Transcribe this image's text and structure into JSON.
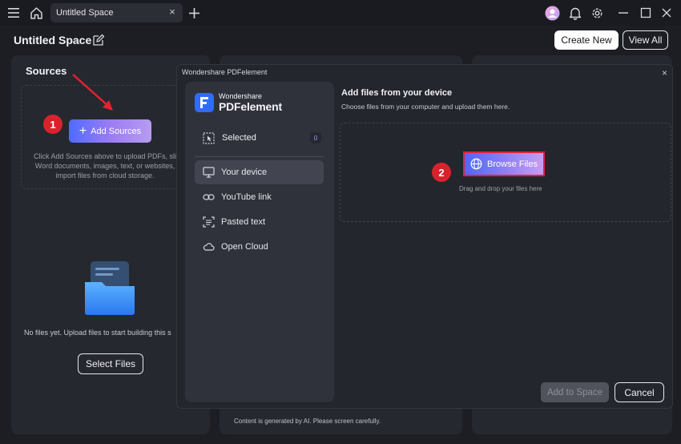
{
  "titlebar": {
    "menu_icon": "hamburger-icon",
    "home_icon": "home-icon",
    "tab_label": "Untitled Space",
    "tab_close": "×",
    "new_tab": "+"
  },
  "header": {
    "space_title": "Untitled Space",
    "create_new": "Create New",
    "view_all": "View All"
  },
  "sources": {
    "title": "Sources",
    "add_sources_label": "Add Sources",
    "help_text": "Click Add Sources above to upload PDFs, sli Word documents, images, text, or websites, import files from cloud storage.",
    "help_line1": "Click Add Sources above to upload PDFs, sli",
    "help_line2": "Word documents, images, text, or websites,",
    "help_line3": "import files from cloud storage.",
    "no_files": "No files yet. Upload files to start building this s",
    "select_files": "Select Files"
  },
  "badges": {
    "one": "1",
    "two": "2"
  },
  "footer": {
    "disclaimer": "Content is generated by AI. Please screen carefully."
  },
  "dialog": {
    "title": "Wondershare PDFelement",
    "close": "×",
    "brand_top": "Wondershare",
    "brand_main": "PDFelement",
    "selected_label": "Selected",
    "selected_count": "0",
    "nav": [
      {
        "label": "Your device",
        "icon": "monitor-icon",
        "active": true
      },
      {
        "label": "YouTube link",
        "icon": "link-icon",
        "active": false
      },
      {
        "label": "Pasted text",
        "icon": "text-scan-icon",
        "active": false
      },
      {
        "label": "Open Cloud",
        "icon": "cloud-icon",
        "active": false
      }
    ],
    "main_title": "Add files from your device",
    "main_subtitle": "Choose files from your computer and upload them here.",
    "browse_label": "Browse Files",
    "drag_text": "Drag and drop your files here",
    "add_to_space": "Add to Space",
    "cancel": "Cancel"
  },
  "colors": {
    "accent_blue": "#4f6bff",
    "badge_red": "#d9232c",
    "background": "#1c1e24"
  }
}
